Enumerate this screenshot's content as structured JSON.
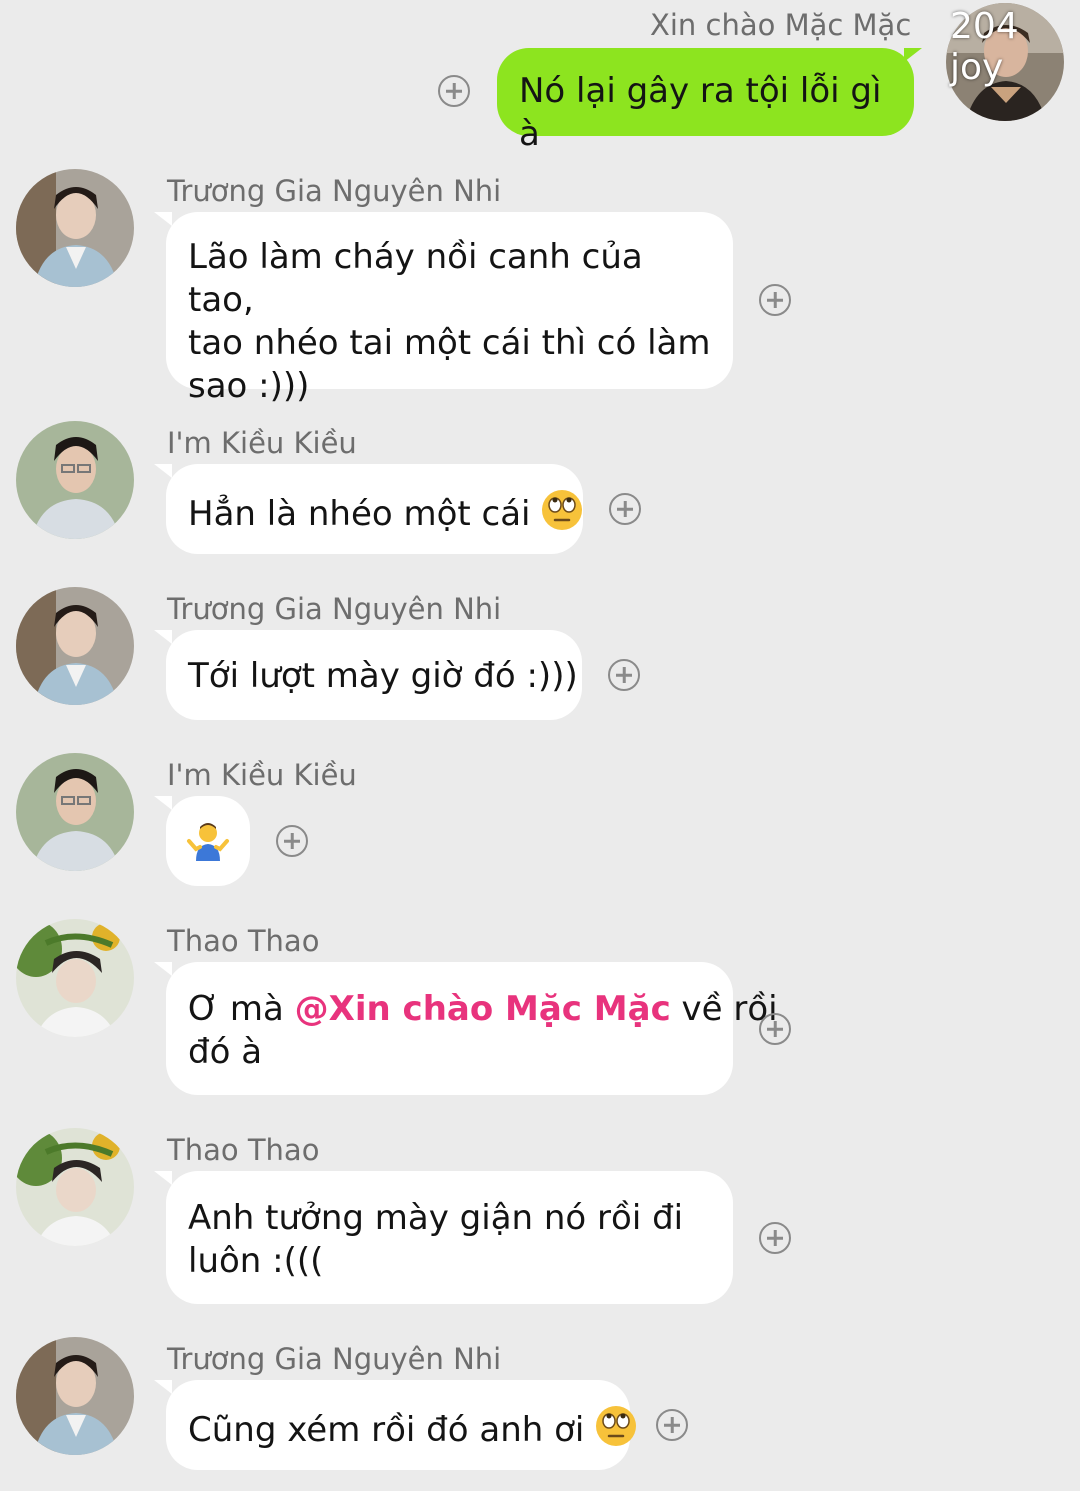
{
  "chat": {
    "outgoing": {
      "sender": "Xin chào Mặc Mặc",
      "text": "Nó lại gây ra tội lỗi gì à",
      "avatar_overlay": "204 joy"
    },
    "messages": [
      {
        "sender": "Trương Gia Nguyên Nhi",
        "lines": [
          "Lão làm cháy nồi canh của tao,",
          "tao nhéo tai một cái thì có làm",
          "sao :)))"
        ]
      },
      {
        "sender": "I'm Kiều Kiều",
        "text": "Hẳn là nhéo một cái",
        "emoji": "eye-roll-emoji"
      },
      {
        "sender": "Trương Gia Nguyên Nhi",
        "text": "Tới lượt mày giờ đó :)))"
      },
      {
        "sender": "I'm Kiều Kiều",
        "emoji": "shrug-emoji"
      },
      {
        "sender": "Thao Thao",
        "text_before": "Ơ mà ",
        "mention": "@Xin chào Mặc Mặc",
        "text_after": " về rồi",
        "line2": "đó à"
      },
      {
        "sender": "Thao Thao",
        "lines": [
          "Anh tưởng mày giận nó rồi đi",
          "luôn :((("
        ]
      },
      {
        "sender": "Trương Gia Nguyên Nhi",
        "text": "Cũng xém rồi đó anh ơi",
        "emoji": "eye-roll-emoji"
      }
    ]
  },
  "colors": {
    "background": "#ebebeb",
    "outgoing_bubble": "#8de41f",
    "incoming_bubble": "#ffffff",
    "mention": "#e8337d",
    "sender_name": "#6d6d6d"
  },
  "icons": [
    "add-reaction-icon"
  ]
}
